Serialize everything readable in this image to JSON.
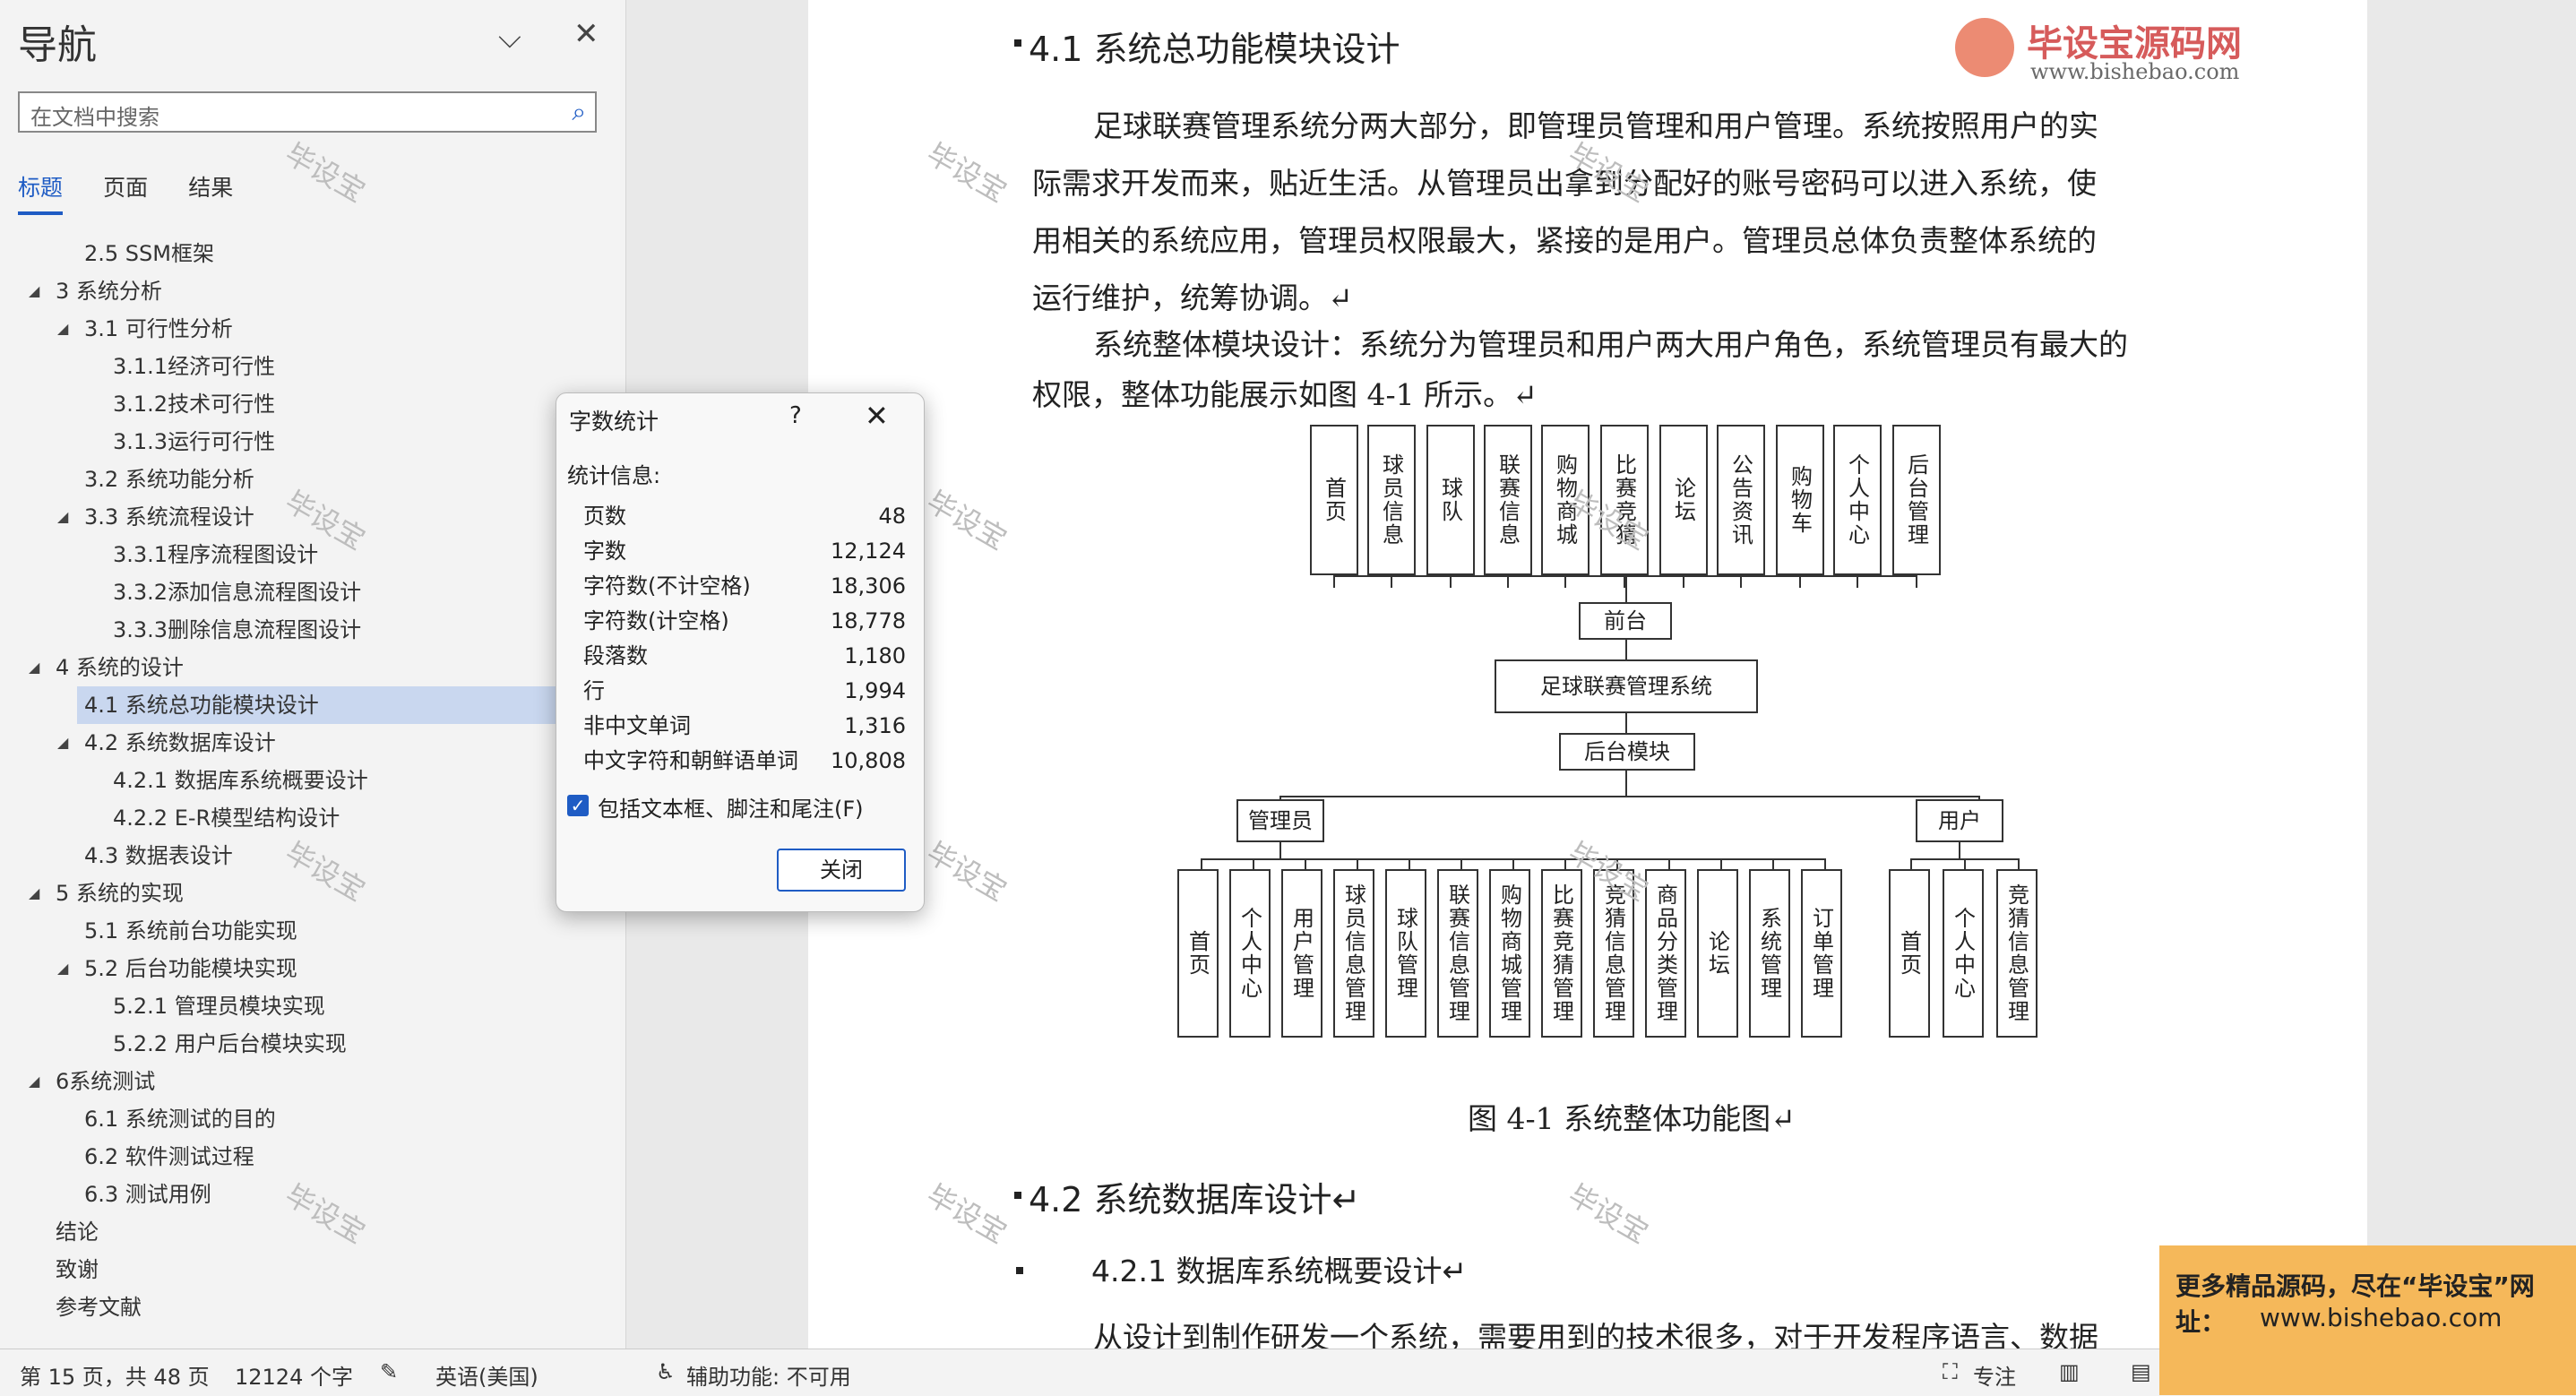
{
  "nav": {
    "title": "导航",
    "search_placeholder": "在文档中搜索",
    "tabs": [
      "标题",
      "页面",
      "结果"
    ],
    "tree": [
      {
        "label": "2.5 SSM框架",
        "level": 2,
        "expander": false
      },
      {
        "label": "3 系统分析",
        "level": 1,
        "expander": true
      },
      {
        "label": "3.1 可行性分析",
        "level": 2,
        "expander": true
      },
      {
        "label": "3.1.1经济可行性",
        "level": 3,
        "expander": false
      },
      {
        "label": "3.1.2技术可行性",
        "level": 3,
        "expander": false
      },
      {
        "label": "3.1.3运行可行性",
        "level": 3,
        "expander": false
      },
      {
        "label": "3.2 系统功能分析",
        "level": 2,
        "expander": false
      },
      {
        "label": "3.3 系统流程设计",
        "level": 2,
        "expander": true
      },
      {
        "label": "3.3.1程序流程图设计",
        "level": 3,
        "expander": false
      },
      {
        "label": "3.3.2添加信息流程图设计",
        "level": 3,
        "expander": false
      },
      {
        "label": "3.3.3删除信息流程图设计",
        "level": 3,
        "expander": false
      },
      {
        "label": "4 系统的设计",
        "level": 1,
        "expander": true
      },
      {
        "label": "4.1 系统总功能模块设计",
        "level": 2,
        "expander": false,
        "selected": true
      },
      {
        "label": "4.2 系统数据库设计",
        "level": 2,
        "expander": true
      },
      {
        "label": "4.2.1 数据库系统概要设计",
        "level": 3,
        "expander": false
      },
      {
        "label": "4.2.2 E-R模型结构设计",
        "level": 3,
        "expander": false
      },
      {
        "label": "4.3 数据表设计",
        "level": 2,
        "expander": false
      },
      {
        "label": "5 系统的实现",
        "level": 1,
        "expander": true
      },
      {
        "label": "5.1 系统前台功能实现",
        "level": 2,
        "expander": false
      },
      {
        "label": "5.2 后台功能模块实现",
        "level": 2,
        "expander": true
      },
      {
        "label": "5.2.1 管理员模块实现",
        "level": 3,
        "expander": false
      },
      {
        "label": "5.2.2 用户后台模块实现",
        "level": 3,
        "expander": false
      },
      {
        "label": "6系统测试",
        "level": 1,
        "expander": true
      },
      {
        "label": "6.1 系统测试的目的",
        "level": 2,
        "expander": false
      },
      {
        "label": "6.2 软件测试过程",
        "level": 2,
        "expander": false
      },
      {
        "label": "6.3 测试用例",
        "level": 2,
        "expander": false
      },
      {
        "label": "结论",
        "level": 1,
        "expander": false
      },
      {
        "label": "致谢",
        "level": 1,
        "expander": false
      },
      {
        "label": "参考文献",
        "level": 1,
        "expander": false
      }
    ]
  },
  "doc": {
    "heading_41": "4.1  系统总功能模块设计",
    "p1_lines": [
      "足球联赛管理系统分两大部分，即管理员管理和用户管理。系统按照用户的实",
      "际需求开发而来，贴近生活。从管理员出拿到分配好的账号密码可以进入系统，使",
      "用相关的系统应用，管理员权限最大，紧接的是用户。管理员总体负责整体系统的",
      "运行维护，统筹协调。↵"
    ],
    "p2_lines": [
      "系统整体模块设计：系统分为管理员和用户两大用户角色，系统管理员有最大的",
      "权限，整体功能展示如图 4-1 所示。↵"
    ],
    "figure_caption": "图 4-1  系统整体功能图↵",
    "heading_42": "4.2  系统数据库设计↵",
    "heading_421": "4.2.1  数据库系统概要设计↵",
    "p3_line": "从设计到制作研发一个系统，需要用到的技术很多，对于开发程序语言、数据"
  },
  "diagram": {
    "top_modules": [
      "首页",
      "球员信息",
      "球队",
      "联赛信息",
      "购物商城",
      "比赛竞猜",
      "论坛",
      "公告资讯",
      "购物车",
      "个人中心",
      "后台管理"
    ],
    "front": "前台",
    "system": "足球联赛管理系统",
    "backend": "后台模块",
    "admin": "管理员",
    "user": "用户",
    "admin_modules": [
      "首页",
      "个人中心",
      "用户管理",
      "球员信息管理",
      "球队管理",
      "联赛信息管理",
      "购物商城管理",
      "比赛竞猜管理",
      "竞猜信息管理",
      "商品分类管理",
      "论坛",
      "系统管理",
      "订单管理"
    ],
    "user_modules": [
      "首页",
      "个人中心",
      "竞猜信息管理"
    ]
  },
  "dialog": {
    "title": "字数统计",
    "help": "?",
    "stats_label": "统计信息:",
    "stats": [
      {
        "k": "页数",
        "v": "48"
      },
      {
        "k": "字数",
        "v": "12,124"
      },
      {
        "k": "字符数(不计空格)",
        "v": "18,306"
      },
      {
        "k": "字符数(计空格)",
        "v": "18,778"
      },
      {
        "k": "段落数",
        "v": "1,180"
      },
      {
        "k": "行",
        "v": "1,994"
      },
      {
        "k": "非中文单词",
        "v": "1,316"
      },
      {
        "k": "中文字符和朝鲜语单词",
        "v": "10,808"
      }
    ],
    "checkbox_label": "包括文本框、脚注和尾注(F)",
    "close_button": "关闭"
  },
  "status": {
    "page": "第 15 页，共 48 页",
    "words": "12124 个字",
    "language": "英语(美国)",
    "accessibility": "辅助功能: 不可用",
    "focus": "专注"
  },
  "watermark": {
    "logo_text": "毕设宝源码网",
    "logo_url": "www.bishebao.com",
    "stamp": "毕设宝"
  },
  "ad": {
    "line1": "更多精品源码，尽在“毕设宝”网址：",
    "line2": "www.bishebao.com"
  }
}
